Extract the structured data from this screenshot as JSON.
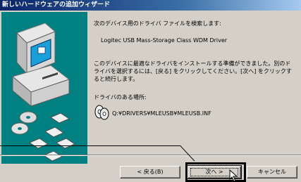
{
  "window": {
    "title": "新しいハードウェアの追加ウィザード"
  },
  "content": {
    "heading": "次のデバイス用のドライバ ファイルを検索します:",
    "device_name": "Logitec USB Mass-Storage Class WDM Driver",
    "message": "このデバイスに最適なドライバをインストールする準備ができました。別のドライバを選択するには、[戻る] をクリックしてください。[次へ] をクリックすると続行します。",
    "location_label": "ドライバのある場所:",
    "driver_path": "Q:¥DRIVERS¥MLEUSB¥MLEUSB.INF",
    "driver_icon": "cd-disk-icon"
  },
  "buttons": {
    "back": "< 戻る(B)",
    "next": "次へ >",
    "cancel": "キャンセル"
  },
  "colors": {
    "title_start": "#0a246a",
    "title_end": "#a6caf0",
    "panel": "#008080",
    "face": "#d4d0c8"
  }
}
